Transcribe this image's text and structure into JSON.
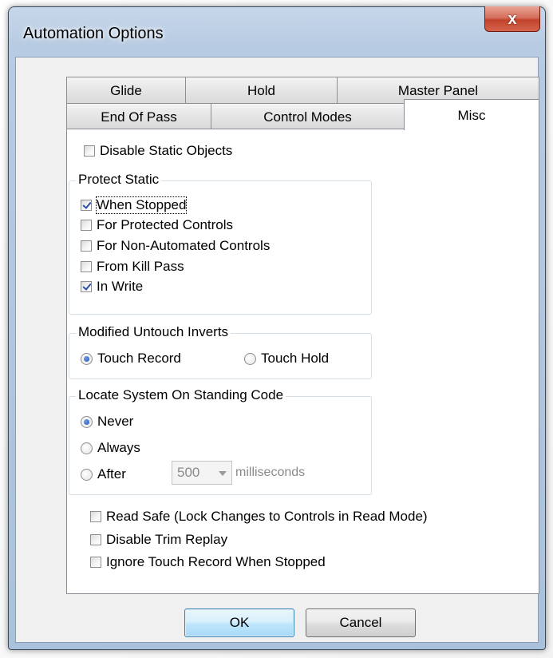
{
  "window": {
    "title": "Automation Options",
    "close_glyph": "x"
  },
  "tabs": {
    "row_back": [
      "Glide",
      "Hold",
      "Master Panel"
    ],
    "row_front": [
      "End Of Pass",
      "Control Modes",
      "Misc"
    ],
    "active": "Misc"
  },
  "misc": {
    "disable_static_objects": {
      "label": "Disable Static Objects",
      "checked": false
    },
    "protect_static": {
      "title": "Protect Static",
      "items": [
        {
          "label": "When Stopped",
          "checked": true
        },
        {
          "label": "For Protected Controls",
          "checked": false
        },
        {
          "label": "For Non-Automated Controls",
          "checked": false
        },
        {
          "label": "From Kill Pass",
          "checked": false
        },
        {
          "label": "In Write",
          "checked": true
        }
      ]
    },
    "modified_untouch_inverts": {
      "title": "Modified Untouch Inverts",
      "options": [
        "Touch Record",
        "Touch Hold"
      ],
      "selected": "Touch Record"
    },
    "locate_system": {
      "title": "Locate System On Standing Code",
      "options": [
        "Never",
        "Always",
        "After"
      ],
      "selected": "Never",
      "after_value": "500",
      "after_unit": "milliseconds"
    },
    "read_safe": {
      "label": "Read Safe  (Lock Changes to Controls in Read Mode)",
      "checked": false
    },
    "disable_trim_replay": {
      "label": "Disable Trim Replay",
      "checked": false
    },
    "ignore_touch_record": {
      "label": "Ignore Touch Record When Stopped",
      "checked": false
    }
  },
  "buttons": {
    "ok": "OK",
    "cancel": "Cancel"
  }
}
